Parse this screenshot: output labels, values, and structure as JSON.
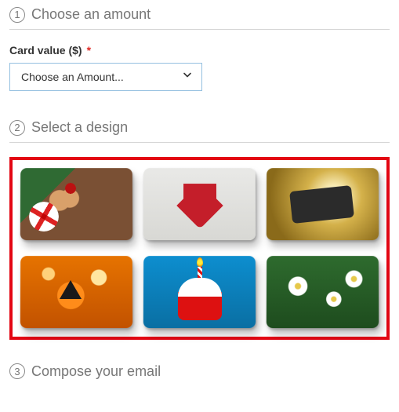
{
  "steps": {
    "s1": {
      "num": "1",
      "title": "Choose an amount"
    },
    "s2": {
      "num": "2",
      "title": "Select a design"
    },
    "s3": {
      "num": "3",
      "title": "Compose your email"
    }
  },
  "amount_field": {
    "label": "Card value ($)",
    "required_mark": "*",
    "placeholder": "Choose an Amount..."
  },
  "designs": [
    {
      "name": "candy-canes-cookies"
    },
    {
      "name": "red-heart-mittens"
    },
    {
      "name": "happy-new-year-gold"
    },
    {
      "name": "halloween-pumpkin"
    },
    {
      "name": "birthday-cupcake"
    },
    {
      "name": "white-daisies"
    }
  ],
  "colors": {
    "highlight_border": "#e30613",
    "select_border": "#94c0e0"
  }
}
